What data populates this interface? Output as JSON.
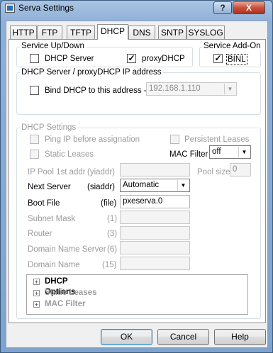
{
  "window": {
    "title": "Serva Settings",
    "help_glyph": "?",
    "close_glyph": "X"
  },
  "tabs": [
    {
      "label": "HTTP"
    },
    {
      "label": "FTP"
    },
    {
      "label": "TFTP"
    },
    {
      "label": "DHCP"
    },
    {
      "label": "DNS"
    },
    {
      "label": "SNTP"
    },
    {
      "label": "SYSLOG"
    }
  ],
  "service_updown": {
    "title": "Service Up/Down",
    "dhcp_server": {
      "label": "DHCP Server",
      "checked": false
    },
    "proxy_dhcp": {
      "label": "proxyDHCP",
      "checked": true
    }
  },
  "service_addon": {
    "title": "Service Add-On",
    "binl": {
      "label": "BINL",
      "checked": true
    }
  },
  "ip_address": {
    "title": "DHCP Server / proxyDHCP IP address",
    "bind_label": "Bind DHCP to this address  ->",
    "bind_checked": false,
    "address_value": "192.168.1.110"
  },
  "dhcp_settings": {
    "title": "DHCP Settings",
    "ping_ip": "Ping IP before assignation",
    "persistent_leases": "Persistent Leases",
    "static_leases": "Static Leases",
    "mac_filter_label": "MAC Filter",
    "mac_filter_value": "off",
    "ip_pool_label": "IP Pool 1st addr",
    "ip_pool_tag": "(yiaddr)",
    "ip_pool_value": "",
    "pool_size_label": "Pool size",
    "pool_size_value": "0",
    "next_server_label": "Next Server",
    "next_server_tag": "(siaddr)",
    "next_server_value": "Automatic",
    "boot_file_label": "Boot File",
    "boot_file_tag": "(file)",
    "boot_file_value": "pxeserva.0",
    "subnet_label": "Subnet Mask",
    "subnet_tag": "(1)",
    "router_label": "Router",
    "router_tag": "(3)",
    "dns_label": "Domain Name Server",
    "dns_tag": "(6)",
    "domain_label": "Domain Name",
    "domain_tag": "(15)"
  },
  "tree": {
    "expand_glyph": "+",
    "items": [
      {
        "label": "DHCP Options",
        "enabled": true
      },
      {
        "label": "Static Leases",
        "enabled": false
      },
      {
        "label": "MAC Filter",
        "enabled": false
      }
    ]
  },
  "buttons": {
    "ok": "OK",
    "cancel": "Cancel",
    "help": "Help"
  },
  "glyphs": {
    "check": "✓",
    "dropdown": "▼"
  }
}
